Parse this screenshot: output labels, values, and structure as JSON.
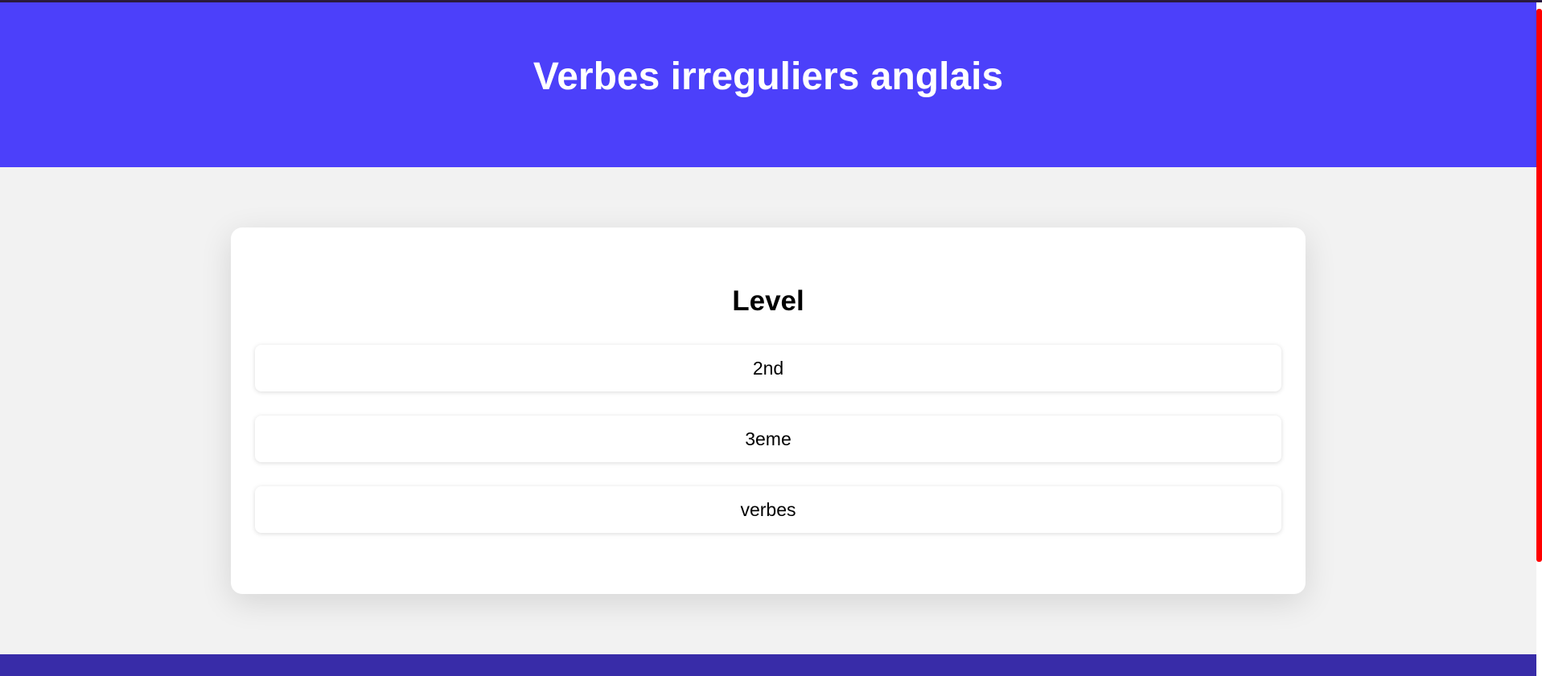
{
  "header": {
    "title": "Verbes irreguliers anglais",
    "background": "#4c40fa"
  },
  "card": {
    "heading": "Level",
    "options": [
      {
        "label": "2nd"
      },
      {
        "label": "3eme"
      },
      {
        "label": "verbes"
      }
    ]
  },
  "footer": {
    "background": "#382ca8"
  },
  "scrollbar": {
    "thumb_color": "#ff0000"
  }
}
